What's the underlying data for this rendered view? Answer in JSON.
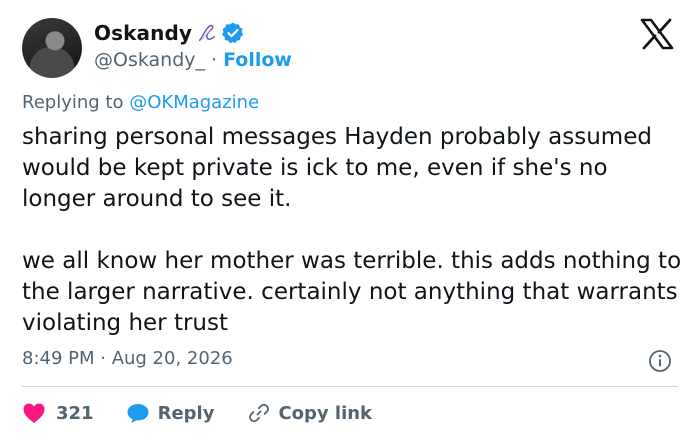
{
  "author": {
    "name": "Oskandy",
    "handle": "@Oskandy_",
    "separator": "·",
    "follow_label": "Follow"
  },
  "tweet": {
    "reply_prefix": "Replying to",
    "reply_target": "@OKMagazine",
    "paragraph_1": "sharing personal messages Hayden probably assumed would be kept private is ick to me, even if she's no longer around to see it.",
    "paragraph_2": "we all know her mother was terrible. this adds nothing to the larger narrative. certainly not anything that warrants violating her trust",
    "timestamp": "8:49 PM · Aug 20, 2026"
  },
  "actions": {
    "like_count": "321",
    "reply_label": "Reply",
    "copy_label": "Copy link"
  },
  "icons": {
    "heart": "heart-icon",
    "reply": "speech-bubble-icon",
    "copy": "link-icon",
    "info": "info-icon",
    "verified": "verified-badge-icon",
    "logo": "x-logo-icon"
  },
  "colors": {
    "accent": "#1d9bf0",
    "heart": "#f91880",
    "secondary_text": "#536471",
    "primary_text": "#0f1419"
  }
}
